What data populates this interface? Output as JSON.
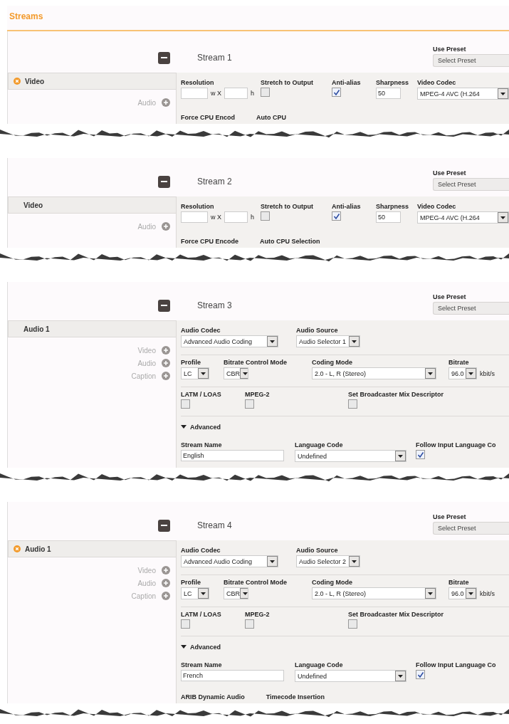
{
  "title": "Streams",
  "streams": [
    {
      "title": "Stream 1",
      "preset_label": "Use Preset",
      "preset": "Select Preset",
      "kind": "video",
      "tab": {
        "label": "Video",
        "removable": true
      },
      "add_items": [
        {
          "label": "Audio"
        }
      ],
      "rows": [
        {
          "kind": "fields",
          "fields": [
            {
              "kind": "resolution",
              "label": "Resolution",
              "sep": "w X",
              "unit": "h"
            },
            {
              "kind": "checkbox",
              "label": "Stretch to Output",
              "checked": false
            },
            {
              "kind": "checkbox",
              "label": "Anti-alias",
              "checked": true
            },
            {
              "kind": "input",
              "label": "Sharpness",
              "value": "50"
            },
            {
              "kind": "select",
              "label": "Video Codec",
              "value": "MPEG-4 AVC (H.264"
            }
          ]
        }
      ],
      "footer": [
        "Force CPU Encod",
        "Auto CPU"
      ]
    },
    {
      "title": "Stream 2",
      "preset_label": "Use Preset",
      "preset": "Select Preset",
      "kind": "video",
      "tab": {
        "label": "Video",
        "removable": false
      },
      "add_items": [
        {
          "label": "Audio"
        }
      ],
      "rows": [
        {
          "kind": "fields",
          "fields": [
            {
              "kind": "resolution",
              "label": "Resolution",
              "sep": "w X",
              "unit": "h"
            },
            {
              "kind": "checkbox",
              "label": "Stretch to Output",
              "checked": false
            },
            {
              "kind": "checkbox",
              "label": "Anti-alias",
              "checked": true
            },
            {
              "kind": "input",
              "label": "Sharpness",
              "value": "50"
            },
            {
              "kind": "select",
              "label": "Video Codec",
              "value": "MPEG-4 AVC (H.264"
            }
          ]
        }
      ],
      "footer": [
        "Force CPU Encode",
        "Auto CPU Selection"
      ]
    },
    {
      "title": "Stream 3",
      "preset_label": "Use Preset",
      "preset": "Select Preset",
      "kind": "audio",
      "tab": {
        "label": "Audio 1",
        "removable": false
      },
      "add_items": [
        {
          "label": "Video"
        },
        {
          "label": "Audio"
        },
        {
          "label": "Caption"
        }
      ],
      "rows": [
        {
          "kind": "fields",
          "fields": [
            {
              "kind": "select",
              "label": "Audio Codec",
              "value": "Advanced Audio Coding"
            },
            {
              "kind": "select",
              "label": "Audio Source",
              "value": "Audio Selector 1"
            }
          ]
        },
        {
          "kind": "fields",
          "fields": [
            {
              "kind": "select",
              "label": "Profile",
              "value": "LC"
            },
            {
              "kind": "select",
              "label": "Bitrate Control Mode",
              "value": "CBR"
            },
            {
              "kind": "select",
              "label": "Coding Mode",
              "value": "2.0 - L, R (Stereo)"
            },
            {
              "kind": "select",
              "label": "Bitrate",
              "value": "96.0",
              "unit": "kbit/s"
            }
          ]
        },
        {
          "kind": "fields",
          "fields": [
            {
              "kind": "checkbox",
              "label": "LATM / LOAS",
              "checked": false
            },
            {
              "kind": "checkbox",
              "label": "MPEG-2",
              "checked": false
            },
            {
              "kind": "checkbox",
              "label": "Set Broadcaster Mix Descriptor",
              "checked": false
            }
          ]
        },
        {
          "kind": "toggle",
          "label": "Advanced",
          "expanded": true
        },
        {
          "kind": "fields",
          "fields": [
            {
              "kind": "input",
              "label": "Stream Name",
              "value": "English"
            },
            {
              "kind": "select",
              "label": "Language Code",
              "value": "Undefined"
            },
            {
              "kind": "checkbox",
              "label": "Follow Input Language Co",
              "checked": true
            }
          ]
        }
      ]
    },
    {
      "title": "Stream 4",
      "preset_label": "Use Preset",
      "preset": "Select Preset",
      "kind": "audio",
      "tab": {
        "label": "Audio 1",
        "removable": true
      },
      "add_items": [
        {
          "label": "Video"
        },
        {
          "label": "Audio"
        },
        {
          "label": "Caption"
        }
      ],
      "rows": [
        {
          "kind": "fields",
          "fields": [
            {
              "kind": "select",
              "label": "Audio Codec",
              "value": "Advanced Audio Coding"
            },
            {
              "kind": "select",
              "label": "Audio Source",
              "value": "Audio Selector 2"
            }
          ]
        },
        {
          "kind": "fields",
          "fields": [
            {
              "kind": "select",
              "label": "Profile",
              "value": "LC"
            },
            {
              "kind": "select",
              "label": "Bitrate Control Mode",
              "value": "CBR"
            },
            {
              "kind": "select",
              "label": "Coding Mode",
              "value": "2.0 - L, R (Stereo)"
            },
            {
              "kind": "select",
              "label": "Bitrate",
              "value": "96.0",
              "unit": "kbit/s"
            }
          ]
        },
        {
          "kind": "fields",
          "fields": [
            {
              "kind": "checkbox",
              "label": "LATM / LOAS",
              "checked": false
            },
            {
              "kind": "checkbox",
              "label": "MPEG-2",
              "checked": false
            },
            {
              "kind": "checkbox",
              "label": "Set Broadcaster Mix Descriptor",
              "checked": false
            }
          ]
        },
        {
          "kind": "toggle",
          "label": "Advanced",
          "expanded": true
        },
        {
          "kind": "fields",
          "fields": [
            {
              "kind": "input",
              "label": "Stream Name",
              "value": "French"
            },
            {
              "kind": "select",
              "label": "Language Code",
              "value": "Undefined"
            },
            {
              "kind": "checkbox",
              "label": "Follow Input Language Co",
              "checked": true
            }
          ]
        }
      ],
      "footer": [
        "ARIB Dynamic Audio",
        "Timecode Insertion"
      ]
    }
  ]
}
